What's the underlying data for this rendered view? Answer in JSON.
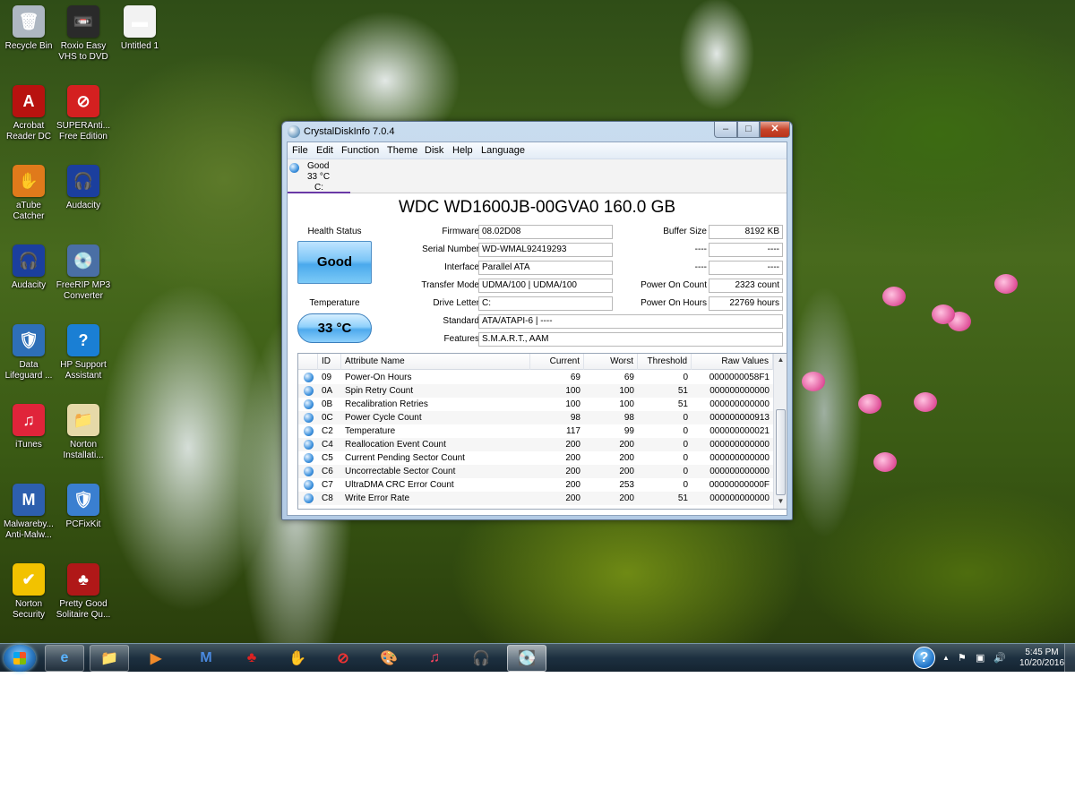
{
  "desktop_icons": [
    {
      "label": "Recycle Bin",
      "icon": "recycle-bin-icon",
      "glyph": "🗑",
      "color": "#aeb7c2"
    },
    {
      "label": "Roxio Easy\nVHS to DVD",
      "icon": "roxio-icon",
      "glyph": "📼",
      "color": "#2a2a2a"
    },
    {
      "label": "Untitled 1",
      "icon": "document-icon",
      "glyph": "▬",
      "color": "#f2f2f2"
    },
    {
      "label": "Acrobat\nReader DC",
      "icon": "acrobat-icon",
      "glyph": "A",
      "color": "#b8120f"
    },
    {
      "label": "SUPERAnti...\nFree Edition",
      "icon": "superantispyware-icon",
      "glyph": "⊘",
      "color": "#d42020"
    },
    {
      "label": "aTube\nCatcher",
      "icon": "atube-catcher-icon",
      "glyph": "✋",
      "color": "#e07a1b"
    },
    {
      "label": "Audacity",
      "icon": "audacity-icon",
      "glyph": "🎧",
      "color": "#1b3f9e"
    },
    {
      "label": "Audacity",
      "icon": "audacity-icon",
      "glyph": "🎧",
      "color": "#1b3f9e"
    },
    {
      "label": "FreeRIP MP3\nConverter",
      "icon": "freerip-icon",
      "glyph": "💿",
      "color": "#4a6fa5"
    },
    {
      "label": "Data\nLifeguard ...",
      "icon": "data-lifeguard-icon",
      "glyph": "🛡",
      "color": "#2e6fb8"
    },
    {
      "label": "HP Support\nAssistant",
      "icon": "hp-support-icon",
      "glyph": "?",
      "color": "#1a7fd4"
    },
    {
      "label": "iTunes",
      "icon": "itunes-icon",
      "glyph": "♫",
      "color": "#e0243a"
    },
    {
      "label": "Norton\nInstallati...",
      "icon": "norton-installation-icon",
      "glyph": "📁",
      "color": "#e6d9a8"
    },
    {
      "label": "Malwareby...\nAnti-Malw...",
      "icon": "malwarebytes-icon",
      "glyph": "M",
      "color": "#2d5fae"
    },
    {
      "label": "PCFixKit",
      "icon": "pcfixkit-icon",
      "glyph": "🛡",
      "color": "#3a7fd0"
    },
    {
      "label": "Norton\nSecurity",
      "icon": "norton-security-icon",
      "glyph": "✔",
      "color": "#f2c200"
    },
    {
      "label": "Pretty Good\nSolitaire Qu...",
      "icon": "solitaire-icon",
      "glyph": "♣",
      "color": "#b01818"
    }
  ],
  "window": {
    "title": "CrystalDiskInfo 7.0.4",
    "controls": {
      "minimize": "–",
      "maximize": "□",
      "close": "✕"
    },
    "menu": [
      "File",
      "Edit",
      "Function",
      "Theme",
      "Disk",
      "Help",
      "Language"
    ],
    "disk_tab": {
      "status": "Good",
      "temp": "33 °C",
      "letter": "C:"
    },
    "model": "WDC WD1600JB-00GVA0 160.0 GB",
    "health_label": "Health Status",
    "health_value": "Good",
    "temp_label": "Temperature",
    "temp_value": "33 °C",
    "info_left": [
      {
        "label": "Firmware",
        "value": "08.02D08"
      },
      {
        "label": "Serial Number",
        "value": "WD-WMAL92419293"
      },
      {
        "label": "Interface",
        "value": "Parallel ATA"
      },
      {
        "label": "Transfer Mode",
        "value": "UDMA/100 | UDMA/100"
      },
      {
        "label": "Drive Letter",
        "value": "C:"
      }
    ],
    "info_wide": [
      {
        "label": "Standard",
        "value": "ATA/ATAPI-6 | ----"
      },
      {
        "label": "Features",
        "value": "S.M.A.R.T., AAM"
      }
    ],
    "info_right": [
      {
        "label": "Buffer Size",
        "value": "8192 KB"
      },
      {
        "label": "----",
        "value": "----"
      },
      {
        "label": "----",
        "value": "----"
      },
      {
        "label": "Power On Count",
        "value": "2323 count"
      },
      {
        "label": "Power On Hours",
        "value": "22769 hours"
      }
    ],
    "table_headers": [
      "ID",
      "Attribute Name",
      "Current",
      "Worst",
      "Threshold",
      "Raw Values"
    ],
    "attributes": [
      [
        "09",
        "Power-On Hours",
        "69",
        "69",
        "0",
        "0000000058F1"
      ],
      [
        "0A",
        "Spin Retry Count",
        "100",
        "100",
        "51",
        "000000000000"
      ],
      [
        "0B",
        "Recalibration Retries",
        "100",
        "100",
        "51",
        "000000000000"
      ],
      [
        "0C",
        "Power Cycle Count",
        "98",
        "98",
        "0",
        "000000000913"
      ],
      [
        "C2",
        "Temperature",
        "117",
        "99",
        "0",
        "000000000021"
      ],
      [
        "C4",
        "Reallocation Event Count",
        "200",
        "200",
        "0",
        "000000000000"
      ],
      [
        "C5",
        "Current Pending Sector Count",
        "200",
        "200",
        "0",
        "000000000000"
      ],
      [
        "C6",
        "Uncorrectable Sector Count",
        "200",
        "200",
        "0",
        "000000000000"
      ],
      [
        "C7",
        "UltraDMA CRC Error Count",
        "200",
        "253",
        "0",
        "00000000000F"
      ],
      [
        "C8",
        "Write Error Rate",
        "200",
        "200",
        "51",
        "000000000000"
      ]
    ],
    "scroll_up": "▲",
    "scroll_down": "▼"
  },
  "taskbar": {
    "items": [
      {
        "icon": "internet-explorer-icon",
        "glyph": "e",
        "color": "#5ab4ff",
        "state": "pinned"
      },
      {
        "icon": "file-explorer-icon",
        "glyph": "📁",
        "color": "#f4d27a",
        "state": "pinned"
      },
      {
        "icon": "media-player-icon",
        "glyph": "▶",
        "color": "#f08a2a",
        "state": "normal"
      },
      {
        "icon": "malwarebytes-icon",
        "glyph": "M",
        "color": "#4a8ae0",
        "state": "normal"
      },
      {
        "icon": "solitaire-icon",
        "glyph": "♣",
        "color": "#d22",
        "state": "normal"
      },
      {
        "icon": "atube-catcher-icon",
        "glyph": "✋",
        "color": "#ff9a2a",
        "state": "normal"
      },
      {
        "icon": "superantispyware-icon",
        "glyph": "⊘",
        "color": "#e33",
        "state": "normal"
      },
      {
        "icon": "paint-icon",
        "glyph": "🎨",
        "color": "#ddd",
        "state": "normal"
      },
      {
        "icon": "itunes-icon",
        "glyph": "♫",
        "color": "#ff4560",
        "state": "normal"
      },
      {
        "icon": "audacity-icon",
        "glyph": "🎧",
        "color": "#f7a21b",
        "state": "normal"
      },
      {
        "icon": "crystaldiskinfo-icon",
        "glyph": "💽",
        "color": "#9cc6ee",
        "state": "active"
      }
    ],
    "tray": {
      "help": "?",
      "arrow": "▲",
      "flag": "⚑",
      "network": "▣",
      "volume": "🔊"
    },
    "time": "5:45 PM",
    "date": "10/20/2016"
  }
}
